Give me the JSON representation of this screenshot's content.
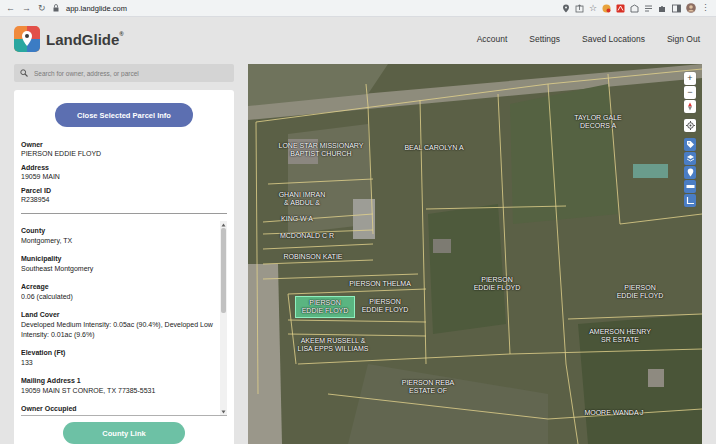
{
  "browser": {
    "nav": [
      "←",
      "→",
      "↻"
    ],
    "url": "app.landglide.com",
    "star": "☆",
    "menu": "⋮"
  },
  "header": {
    "brand": "LandGlide",
    "mark": "®",
    "nav": [
      "Account",
      "Settings",
      "Saved Locations",
      "Sign Out"
    ]
  },
  "search": {
    "placeholder": "Search for owner, address, or parcel"
  },
  "panel": {
    "close_button": "Close Selected Parcel Info",
    "summary": [
      {
        "label": "Owner",
        "value": "PIERSON EDDIE FLOYD"
      },
      {
        "label": "Address",
        "value": "19059 MAIN"
      },
      {
        "label": "Parcel ID",
        "value": "R238954"
      }
    ],
    "details": [
      {
        "label": "County",
        "value": "Montgomery, TX"
      },
      {
        "label": "Municipality",
        "value": "Southeast Montgomery"
      },
      {
        "label": "Acreage",
        "value": "0.06 (calculated)"
      },
      {
        "label": "Land Cover",
        "value": "Developed Medium Intensity: 0.05ac (90.4%), Developed Low Intensity: 0.01ac (9.6%)"
      },
      {
        "label": "Elevation (Ft)",
        "value": "133"
      },
      {
        "label": "Mailing Address 1",
        "value": "19059 MAIN ST CONROE, TX 77385-5531"
      },
      {
        "label": "Owner Occupied",
        "value": ""
      }
    ],
    "scrollbar": {
      "level": 0.47
    },
    "county_link": "County Link"
  },
  "map": {
    "zoom": [
      "+",
      "−"
    ],
    "labels": [
      {
        "lines": [
          "LONE STAR MISSIONARY",
          "BAPTIST CHURCH"
        ],
        "selected": false
      },
      {
        "lines": [
          "BEAL CAROLYN A"
        ],
        "selected": false
      },
      {
        "lines": [
          "TAYLOR GALE",
          "DECORS A"
        ],
        "selected": false
      },
      {
        "lines": [
          "GHANI IMRAN",
          "& ABDUL &"
        ],
        "selected": false
      },
      {
        "lines": [
          "KING W A"
        ],
        "selected": false
      },
      {
        "lines": [
          "MCDONALD C R"
        ],
        "selected": false
      },
      {
        "lines": [
          "ROBINSON KATIE"
        ],
        "selected": false
      },
      {
        "lines": [
          "PIERSON THELMA"
        ],
        "selected": false
      },
      {
        "lines": [
          "PIERSON",
          "EDDIE FLOYD"
        ],
        "selected": true
      },
      {
        "lines": [
          "PIERSON",
          "EDDIE FLOYD"
        ],
        "selected": false
      },
      {
        "lines": [
          "PIERSON",
          "EDDIE FLOYD"
        ],
        "selected": false
      },
      {
        "lines": [
          "PIERSON",
          "EDDIE FLOYD"
        ],
        "selected": false
      },
      {
        "lines": [
          "AKEEM RUSSELL &",
          "LISA EPPS WILLIAMS"
        ],
        "selected": false
      },
      {
        "lines": [
          "AMERSON HENRY",
          "SR ESTATE"
        ],
        "selected": false
      },
      {
        "lines": [
          "PIERSON REBA",
          "ESTATE OF"
        ],
        "selected": false
      },
      {
        "lines": [
          "MOORE WANDA J"
        ],
        "selected": false
      }
    ]
  }
}
